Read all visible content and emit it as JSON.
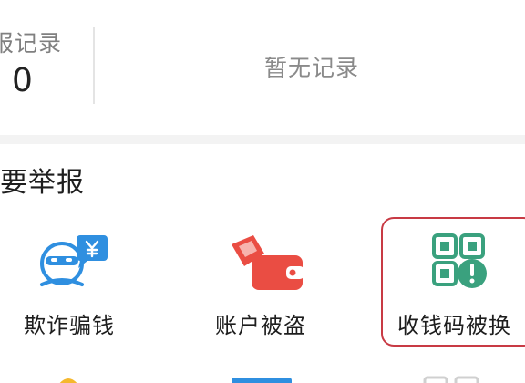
{
  "record": {
    "label": "报记录",
    "count": "0",
    "empty_text": "暂无记录"
  },
  "report_section": {
    "title": "要举报",
    "items": [
      {
        "label": "欺诈骗钱",
        "icon": "fraud-money-icon"
      },
      {
        "label": "账户被盗",
        "icon": "stolen-wallet-icon"
      },
      {
        "label": "收钱码被换",
        "icon": "payment-qr-replaced-icon"
      }
    ]
  },
  "colors": {
    "accent_blue": "#2f8fe0",
    "accent_red": "#ea4d43",
    "accent_teal": "#3aa17e",
    "highlight_border": "#c83a44"
  }
}
